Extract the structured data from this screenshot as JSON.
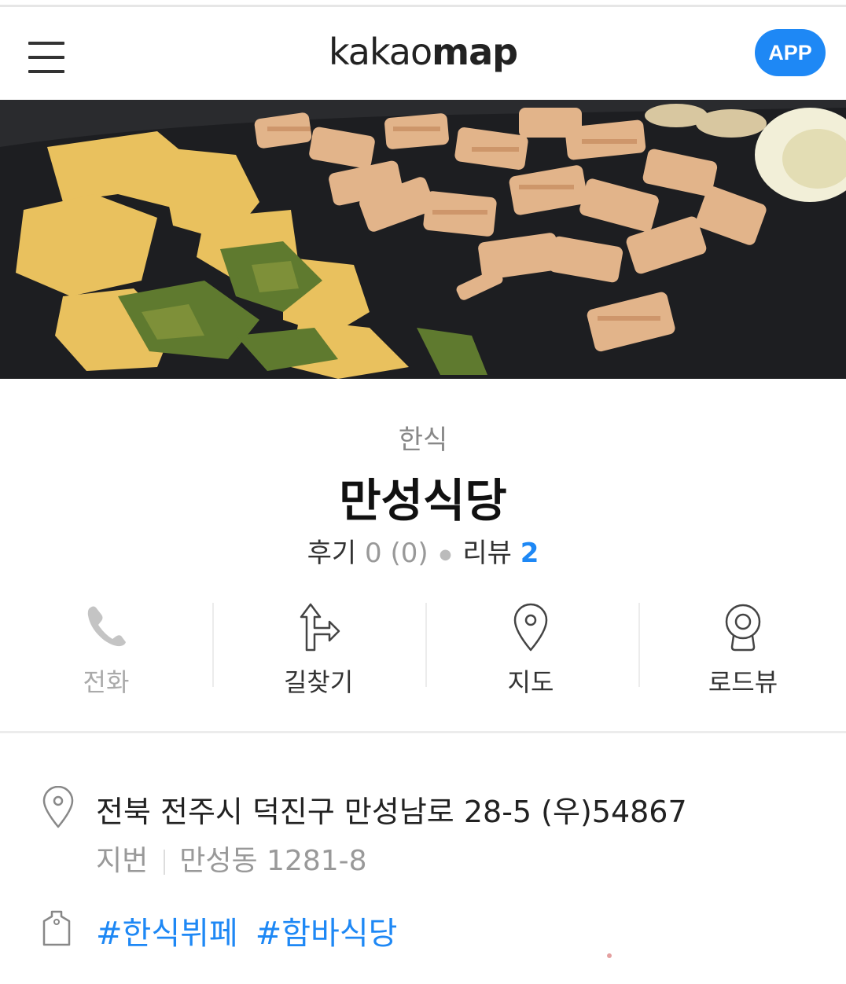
{
  "header": {
    "logo_light": "kakao",
    "logo_bold": "map",
    "app_button": "APP"
  },
  "place": {
    "category": "한식",
    "name": "만성식당",
    "reviews_label": "후기",
    "reviews_value": "0 (0)",
    "blog_reviews_label": "리뷰",
    "blog_reviews_value": "2"
  },
  "actions": [
    {
      "label": "전화",
      "icon": "phone-icon",
      "enabled": false
    },
    {
      "label": "길찾기",
      "icon": "directions-icon",
      "enabled": true
    },
    {
      "label": "지도",
      "icon": "map-pin-icon",
      "enabled": true
    },
    {
      "label": "로드뷰",
      "icon": "roadview-icon",
      "enabled": true
    }
  ],
  "info": {
    "address": "전북 전주시 덕진구 만성남로 28-5 (우)54867",
    "jibun_label": "지번",
    "jibun_value": "만성동 1281-8",
    "tags": [
      "#한식뷔페",
      "#함바식당"
    ]
  },
  "colors": {
    "accent": "#1e88f5",
    "text": "#222222",
    "muted": "#999999"
  }
}
